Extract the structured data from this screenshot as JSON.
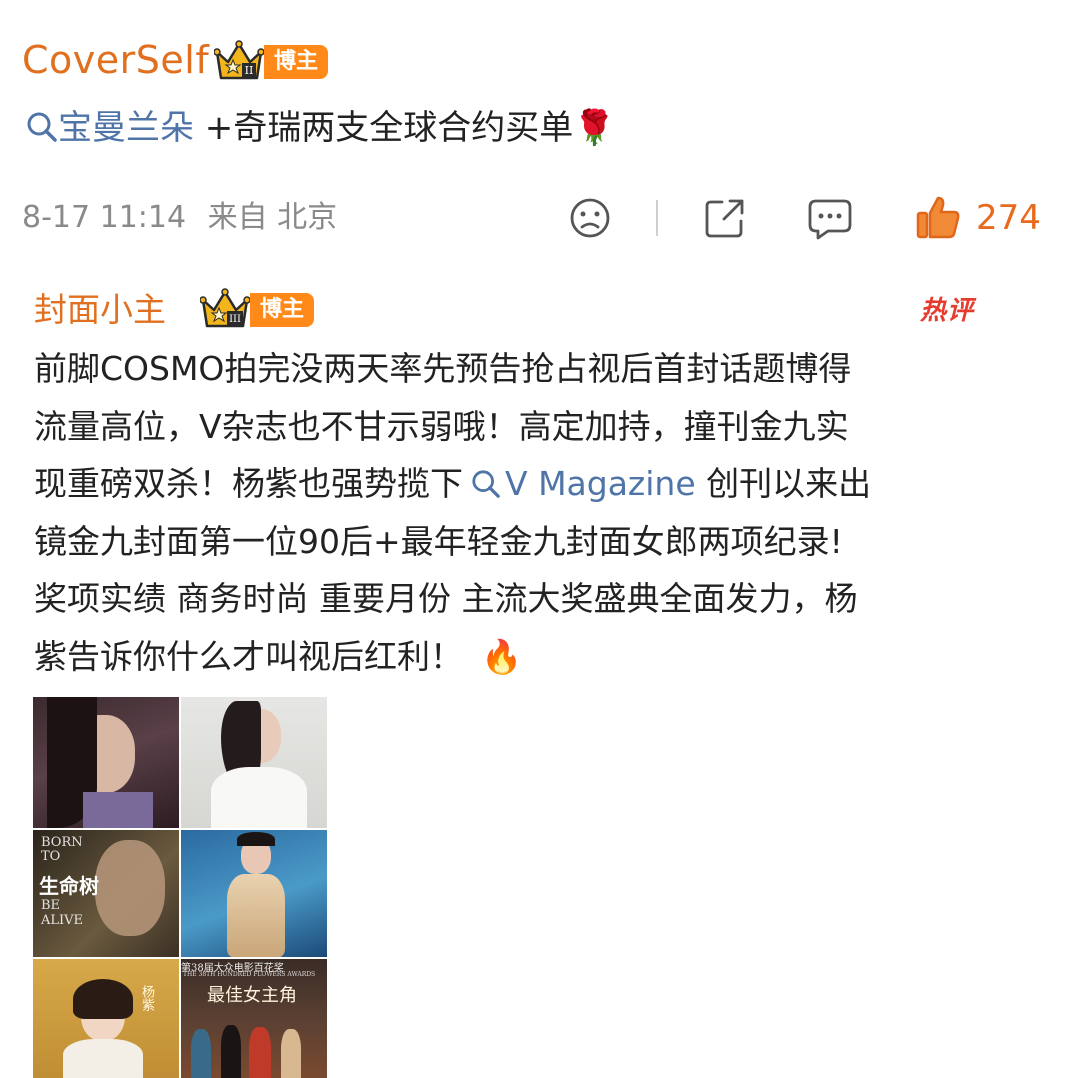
{
  "post": {
    "username": "CoverSelf",
    "crown_level": "II",
    "badge": "博主",
    "topic": "宝曼兰朵",
    "text": " +奇瑞两支全球合约买单",
    "emoji": "🌹",
    "timestamp": "8-17 11:14",
    "source": "来自 北京",
    "like_count": "274",
    "icons": [
      "sad-face-icon",
      "share-icon",
      "comment-icon",
      "like-icon",
      "search-icon"
    ]
  },
  "comment": {
    "username": "封面小主",
    "crown_level": "III",
    "badge": "博主",
    "hot_label": "热评",
    "lines": [
      {
        "text": "前脚COSMO拍完没两天率先预告抢占视后首封话题博得"
      },
      {
        "text": "流量高位，V杂志也不甘示弱哦！高定加持，撞刊金九实"
      },
      {
        "pre": "现重磅双杀！杨紫也强势揽下",
        "link": "V Magazine",
        "post": " 创刊以来出"
      },
      {
        "text": "镜金九封面第一位90后+最年轻金九封面女郎两项纪录!"
      },
      {
        "text": "奖项实绩 商务时尚 重要月份 主流大奖盛典全面发力，杨"
      },
      {
        "text": "紫告诉你什么才叫视后红利！",
        "emoji": "🔥"
      }
    ]
  },
  "images": {
    "tile3_line1": "BORN",
    "tile3_line2": "TO",
    "tile3_line3": "BE",
    "tile3_line4": "ALIVE",
    "tile3_title": "生命树",
    "tile5_name": "杨紫",
    "tile6_banner": "第38届大众电影百花奖",
    "tile6_sub": "THE 38TH HUNDRED FLOWERS AWARDS",
    "tile6_title": "最佳女主角"
  },
  "colors": {
    "orange": "#e07020",
    "link_blue": "#4f74a8",
    "meta_gray": "#8a8a8a",
    "hot_red": "#e63c2e"
  }
}
